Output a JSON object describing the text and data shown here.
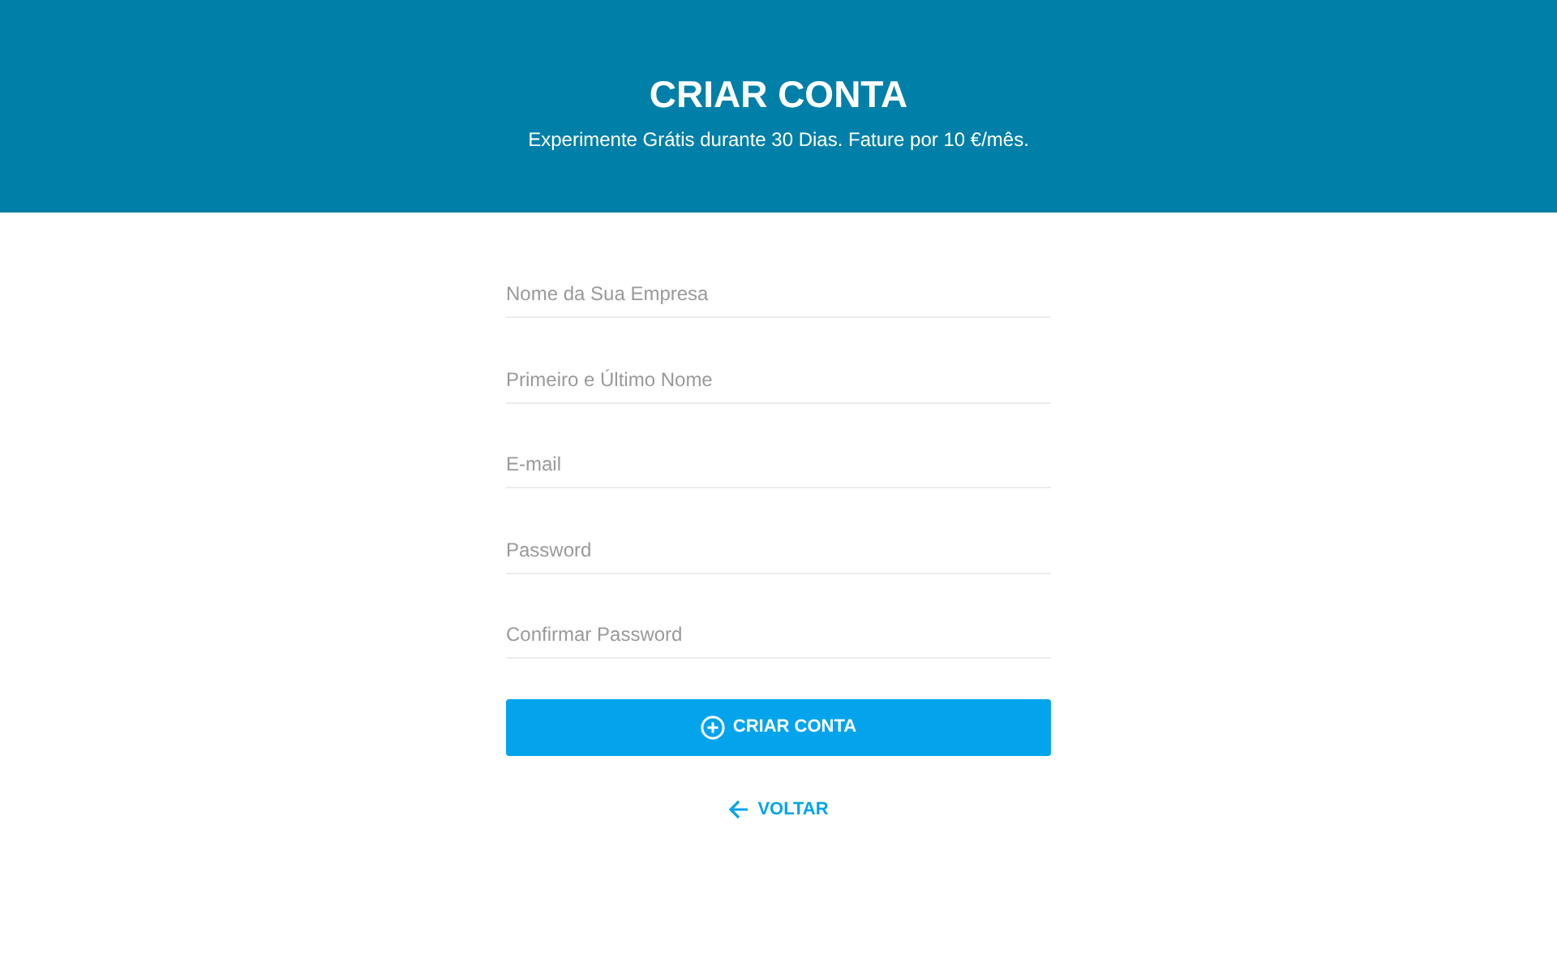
{
  "header": {
    "title": "CRIAR CONTA",
    "subtitle": "Experimente Grátis durante 30 Dias. Fature por 10 €/mês."
  },
  "fields": [
    {
      "placeholder": "Nome da Sua Empresa"
    },
    {
      "placeholder": "Primeiro e Último Nome"
    },
    {
      "placeholder": "E-mail"
    },
    {
      "placeholder": "Password"
    },
    {
      "placeholder": "Confirmar Password"
    }
  ],
  "submit_button": "CRIAR CONTA",
  "back_link": "VOLTAR"
}
